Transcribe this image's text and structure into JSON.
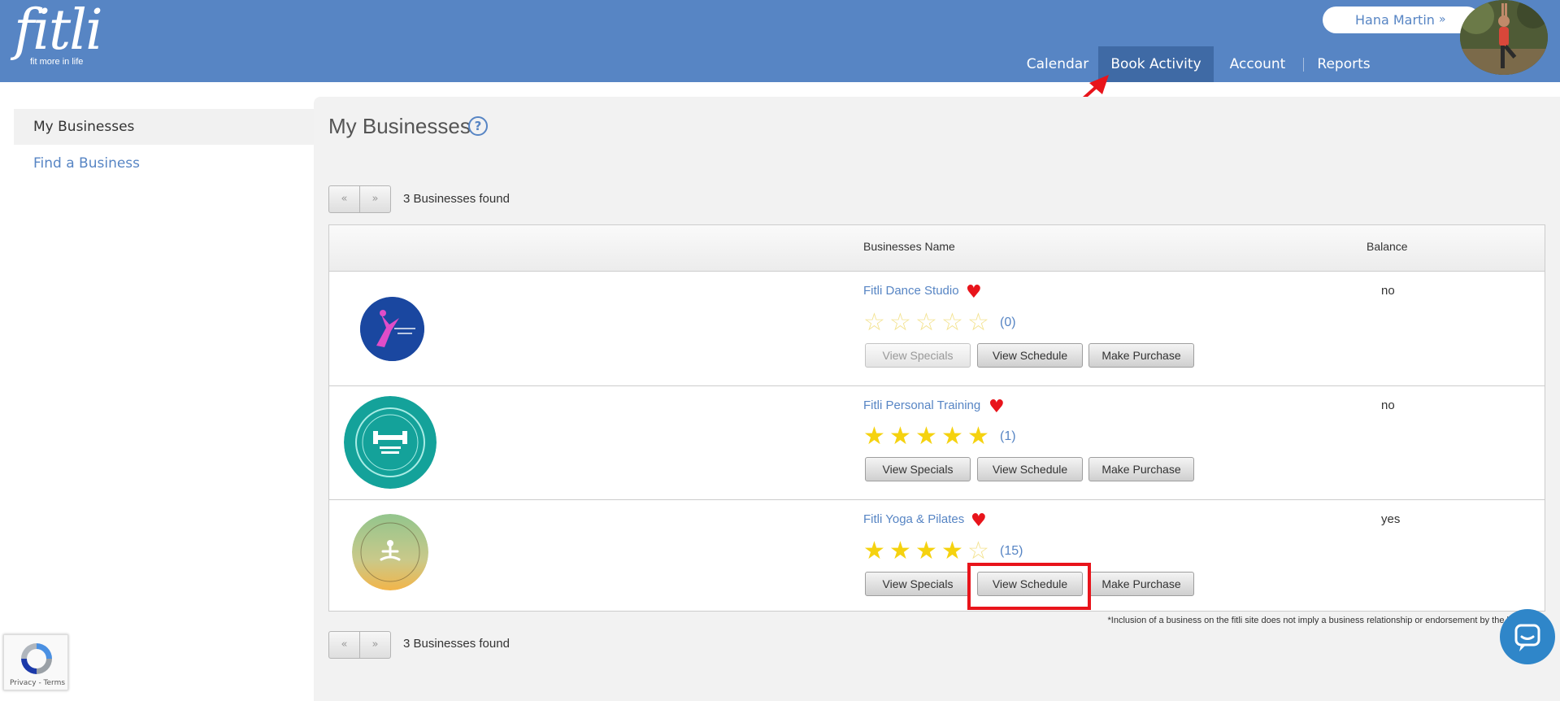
{
  "brand": {
    "logo_text": "fitli",
    "tagline": "fit more in life"
  },
  "user": {
    "name": "Hana Martin",
    "menu_icon": "chevron-double-down-icon"
  },
  "nav": [
    {
      "label": "Calendar"
    },
    {
      "label": "Book Activity",
      "active": true
    },
    {
      "label": "Account"
    },
    {
      "label": "Reports"
    }
  ],
  "sidebar": {
    "items": [
      {
        "label": "My Businesses",
        "active": true
      },
      {
        "label": "Find a Business"
      }
    ]
  },
  "page": {
    "title": "My Businesses",
    "help_icon": "?"
  },
  "pager": {
    "prev": "«",
    "next": "»",
    "found_text": "3 Businesses found"
  },
  "table": {
    "headers": {
      "name": "Businesses Name",
      "balance": "Balance"
    },
    "buttons": {
      "specials": "View Specials",
      "schedule": "View Schedule",
      "purchase": "Make Purchase"
    },
    "rows": [
      {
        "name": "Fitli Dance Studio",
        "rating": 0,
        "rating_count": "(0)",
        "balance": "no",
        "specials_enabled": false
      },
      {
        "name": "Fitli Personal Training",
        "rating": 5,
        "rating_count": "(1)",
        "balance": "no",
        "specials_enabled": true
      },
      {
        "name": "Fitli Yoga & Pilates",
        "rating": 4,
        "rating_count": "(15)",
        "balance": "yes",
        "specials_enabled": true
      }
    ]
  },
  "disclaimer": "*Inclusion of a business on the fitli site does not imply a business relationship or endorsement by the business.",
  "recaptcha": {
    "links": "Privacy - Terms"
  },
  "colors": {
    "header": "#5785c4",
    "active_tab": "#3f6aa5",
    "star": "#f5d20f",
    "heart": "#e8141b",
    "highlight": "#e8141b"
  }
}
